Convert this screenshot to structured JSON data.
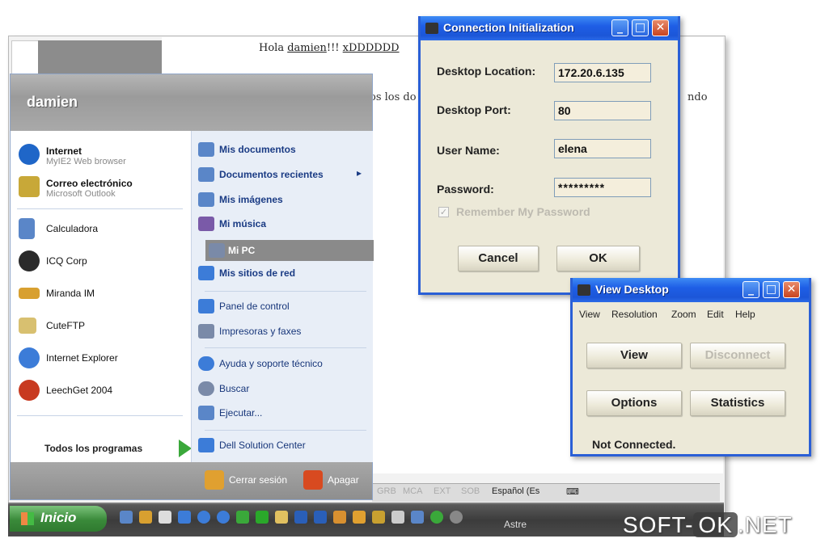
{
  "document": {
    "greeting_prefix": "Hola",
    "greeting_name": "damien",
    "greeting_mid": "!!!",
    "greeting_smiley": "xDDDDDD",
    "fragment1": "os los do",
    "fragment2": "ndo"
  },
  "start_menu": {
    "user": "damien",
    "pinned": [
      {
        "label": "Internet",
        "sub": "MyIE2 Web browser",
        "icon": "browser-icon",
        "color": "#1f66c8"
      },
      {
        "label": "Correo electrónico",
        "sub": "Microsoft Outlook",
        "icon": "mail-icon",
        "color": "#c8a838"
      }
    ],
    "recent": [
      {
        "label": "Calculadora",
        "icon": "calculator-icon",
        "color": "#5a86c8"
      },
      {
        "label": "ICQ Corp",
        "icon": "icq-icon",
        "color": "#2a2a2a"
      },
      {
        "label": "Miranda IM",
        "icon": "miranda-icon",
        "color": "#d8a030"
      },
      {
        "label": "CuteFTP",
        "icon": "ftp-icon",
        "color": "#d8c070"
      },
      {
        "label": "Internet Explorer",
        "icon": "ie-icon",
        "color": "#3c7cd8"
      },
      {
        "label": "LeechGet 2004",
        "icon": "leechget-icon",
        "color": "#c83a20"
      }
    ],
    "all_programs": "Todos los programas",
    "places_primary": [
      {
        "label": "Mis documentos",
        "icon": "documents-icon",
        "color": "#5a86c8"
      },
      {
        "label": "Documentos recientes",
        "icon": "recent-docs-icon",
        "color": "#5a86c8",
        "arrow": "▸"
      },
      {
        "label": "Mis imágenes",
        "icon": "pictures-icon",
        "color": "#5a86c8"
      },
      {
        "label": "Mi música",
        "icon": "music-icon",
        "color": "#7a5aa8"
      },
      {
        "label": "Mi PC",
        "icon": "computer-icon",
        "color": "#7a8aa8"
      },
      {
        "label": "Mis sitios de red",
        "icon": "network-icon",
        "color": "#3c7cd8"
      }
    ],
    "places_secondary": [
      {
        "label": "Panel de control",
        "icon": "control-panel-icon",
        "color": "#3c7cd8"
      },
      {
        "label": "Impresoras y faxes",
        "icon": "printer-icon",
        "color": "#7a8aa8"
      }
    ],
    "places_tertiary": [
      {
        "label": "Ayuda y soporte técnico",
        "icon": "help-icon",
        "color": "#3c7cd8"
      },
      {
        "label": "Buscar",
        "icon": "search-icon",
        "color": "#7a8aa8"
      },
      {
        "label": "Ejecutar...",
        "icon": "run-icon",
        "color": "#5a86c8"
      }
    ],
    "places_extra": [
      {
        "label": "Dell Solution Center",
        "icon": "dell-icon",
        "color": "#3c7cd8"
      }
    ],
    "logoff": "Cerrar sesión",
    "shutdown": "Apagar"
  },
  "status_bar": [
    "GRB",
    "MCA",
    "EXT",
    "SOB",
    "Español (Es"
  ],
  "taskbar": {
    "start_label": "Inicio",
    "tray_text": "Astre"
  },
  "connection_dialog": {
    "title": "Connection Initialization",
    "desktop_location_label": "Desktop Location:",
    "desktop_location_value": "172.20.6.135",
    "desktop_port_label": "Desktop Port:",
    "desktop_port_value": "80",
    "user_name_label": "User Name:",
    "user_name_value": "elena",
    "password_label": "Password:",
    "password_value": "*********",
    "remember_label": "Remember My Password",
    "cancel": "Cancel",
    "ok": "OK"
  },
  "view_desktop": {
    "title": "View Desktop",
    "menu": [
      "View",
      "Resolution",
      "Zoom",
      "Edit",
      "Help"
    ],
    "view_btn": "View",
    "disconnect_btn": "Disconnect",
    "options_btn": "Options",
    "statistics_btn": "Statistics",
    "status": "Not Connected."
  },
  "watermark": {
    "part1": "SOFT-",
    "part2": "OK",
    "part3": ".NET"
  },
  "colors": {
    "xp_blue": "#1e5ee6",
    "dialog_bg": "#ece9d8",
    "close_red": "#c94420"
  }
}
